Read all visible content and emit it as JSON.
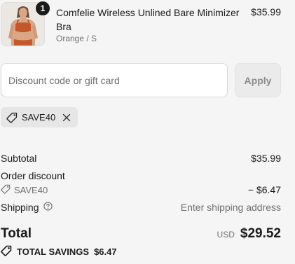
{
  "product": {
    "image_icon": "product-photo",
    "quantity": "1",
    "name": "Comfelie Wireless Unlined Bare Minimizer Bra",
    "variant": "Orange / S",
    "price": "$35.99"
  },
  "discount": {
    "placeholder": "Discount code or gift card",
    "value": "",
    "apply_label": "Apply",
    "applied_code": "SAVE40",
    "tag_icon": "tag-icon",
    "remove_icon": "close-icon"
  },
  "summary": {
    "subtotal_label": "Subtotal",
    "subtotal_value": "$35.99",
    "order_discount_label": "Order discount",
    "order_discount_code": "SAVE40",
    "order_discount_value": "− $6.47",
    "shipping_label": "Shipping",
    "shipping_help_icon": "help-circle-icon",
    "shipping_value": "Enter shipping address",
    "total_label": "Total",
    "currency": "USD",
    "total_value": "$29.52",
    "savings_label": "TOTAL SAVINGS",
    "savings_value": "$6.47"
  },
  "colors": {
    "background": "#f5f5f5",
    "text": "#1a1a1a",
    "muted": "#707070",
    "product_orange": "#c2582c"
  }
}
